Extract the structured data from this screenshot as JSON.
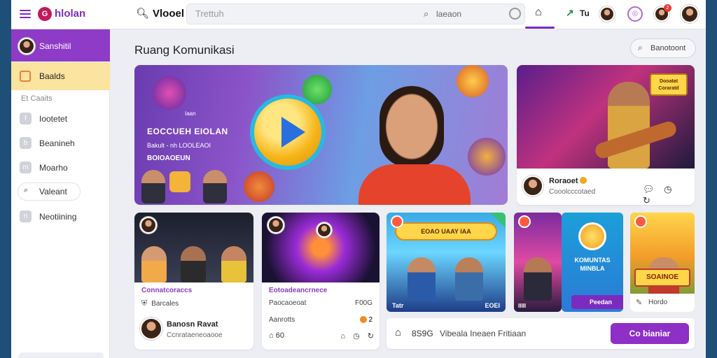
{
  "header": {
    "logo_mark": "G",
    "logo_text": "hlolan",
    "brand2": "Vlooel",
    "search_placeholder": "Trettuh",
    "search_hint": "laeaon",
    "trend_label": "Tu",
    "notif_count": "2"
  },
  "sidebar": {
    "profile_name": "Sanshitil",
    "active_item": "Baalds",
    "section_label": "Et Caaits",
    "items": [
      {
        "label": "Iootetet",
        "icon": "f"
      },
      {
        "label": "Beanineh",
        "icon": "b"
      },
      {
        "label": "Moarho",
        "icon": "m"
      },
      {
        "label": "Valeant",
        "icon": "s"
      },
      {
        "label": "Neotiining",
        "icon": "n"
      }
    ]
  },
  "main": {
    "page_title": "Ruang Komunikasi",
    "filter_label": "Banotoont"
  },
  "hero": {
    "tag": "Iaan",
    "title": "EOCCUEH EIOLAN",
    "subtitle": "Bakult - nh LOOLEAOI",
    "subtitle2": "BOIOAOEUN"
  },
  "featured": {
    "badge": "Dooatat Coraratd",
    "author": "Roraoet",
    "subtitle": "Cooolcccotaed"
  },
  "cards": [
    {
      "title": "Connatcoraccs",
      "meta_icon": "shield",
      "meta": "Barcales",
      "author": "Banosn Ravat",
      "author_sub": "Ccnrataeneoaooe"
    },
    {
      "title": "Eotoadeancrnece",
      "meta": "Paocaoeoat",
      "price": "F00G",
      "row2": "Aanrotts",
      "row2_num": "2",
      "row3_num": "60"
    }
  ],
  "thumbs": [
    {
      "banner": "EOAO UAAY IAA",
      "label": "Tatr",
      "price": "EOEI"
    },
    {
      "label": "IIIII"
    },
    {
      "title": "KOMUNTAS MINBLA",
      "button": "Peedan"
    },
    {
      "banner": "SOAINOE",
      "caption": "Hordo"
    }
  ],
  "bottombar": {
    "num": "8S9G",
    "text": "Vibeala Ineaen Fritiaan",
    "cta": "Co bianiar"
  }
}
